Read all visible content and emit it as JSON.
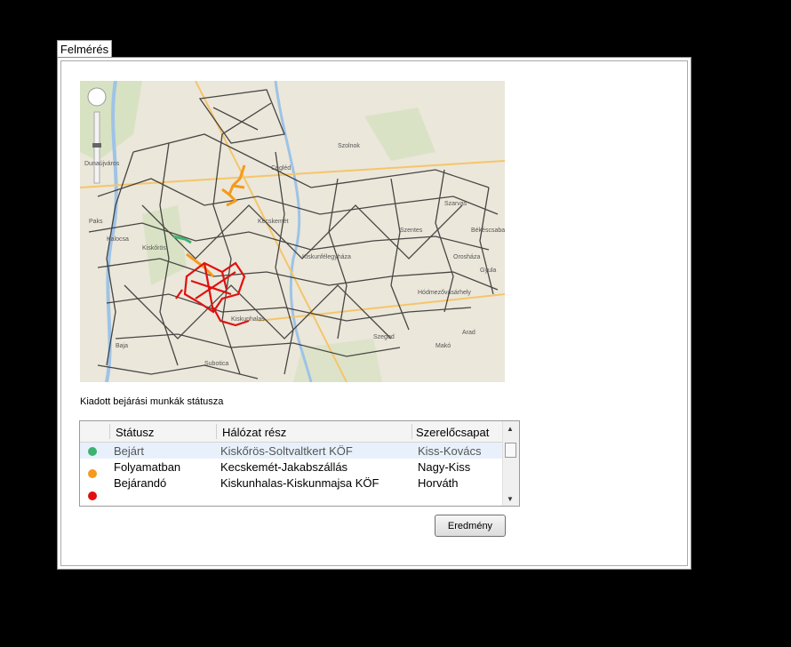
{
  "tab": {
    "label": "Felmérés"
  },
  "caption": "Kiadott bejárási munkák státusza",
  "table": {
    "headers": [
      "Státusz",
      "Hálózat rész",
      "Szerelőcsapat"
    ],
    "rows": [
      {
        "status": "Bejárt",
        "network": "Kiskőrös-Soltvaltkert KÖF",
        "team": "Kiss-Kovács"
      },
      {
        "status": "Folyamatban",
        "network": "Kecskemét-Jakabszállás",
        "team": "Nagy-Kiss"
      },
      {
        "status": "Bejárandó",
        "network": "Kiskunhalas-Kiskunmajsa KÖF",
        "team": "Horváth"
      }
    ],
    "status_colors": [
      "#3cb371",
      "#f59a1c",
      "#e01010"
    ]
  },
  "map": {
    "labels": [
      "Szolnok",
      "Cegléd",
      "Kecskemét",
      "Kiskunfélegyháza",
      "Szeged",
      "Makó",
      "Szentes",
      "Hódmezővásárhely",
      "Baja",
      "Kalocsa",
      "Paks",
      "Subotica",
      "Kiskunhalas",
      "Kiskőrös",
      "Orosháza",
      "Békéscsaba",
      "Gyula",
      "Arad",
      "Dunaújváros",
      "Szarvas"
    ]
  },
  "button": {
    "label": "Eredmény"
  }
}
